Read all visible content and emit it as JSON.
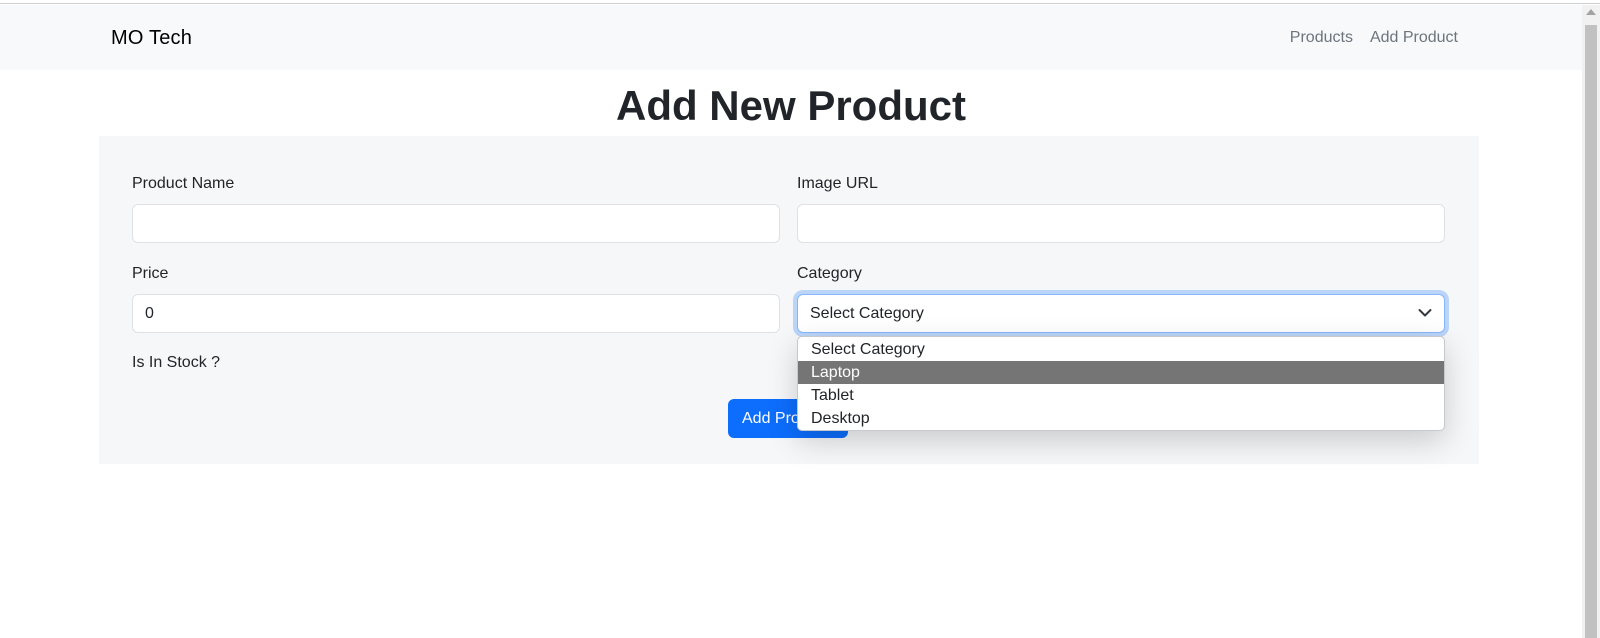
{
  "navbar": {
    "brand": "MO Tech",
    "links": [
      {
        "label": "Products"
      },
      {
        "label": "Add Product"
      }
    ]
  },
  "page_title": "Add New Product",
  "form": {
    "product_name": {
      "label": "Product Name",
      "value": ""
    },
    "image_url": {
      "label": "Image URL",
      "value": ""
    },
    "price": {
      "label": "Price",
      "value": "0"
    },
    "category": {
      "label": "Category",
      "selected": "Select Category",
      "options": [
        "Select Category",
        "Laptop",
        "Tablet",
        "Desktop"
      ],
      "highlighted_option": "Laptop"
    },
    "in_stock": {
      "label": "Is In Stock ?"
    },
    "submit_label": "Add Product"
  },
  "colors": {
    "primary": "#0d6efd",
    "navbar_bg": "#f8f9fa",
    "highlight": "#757575",
    "focus_border": "#86b7fe"
  }
}
